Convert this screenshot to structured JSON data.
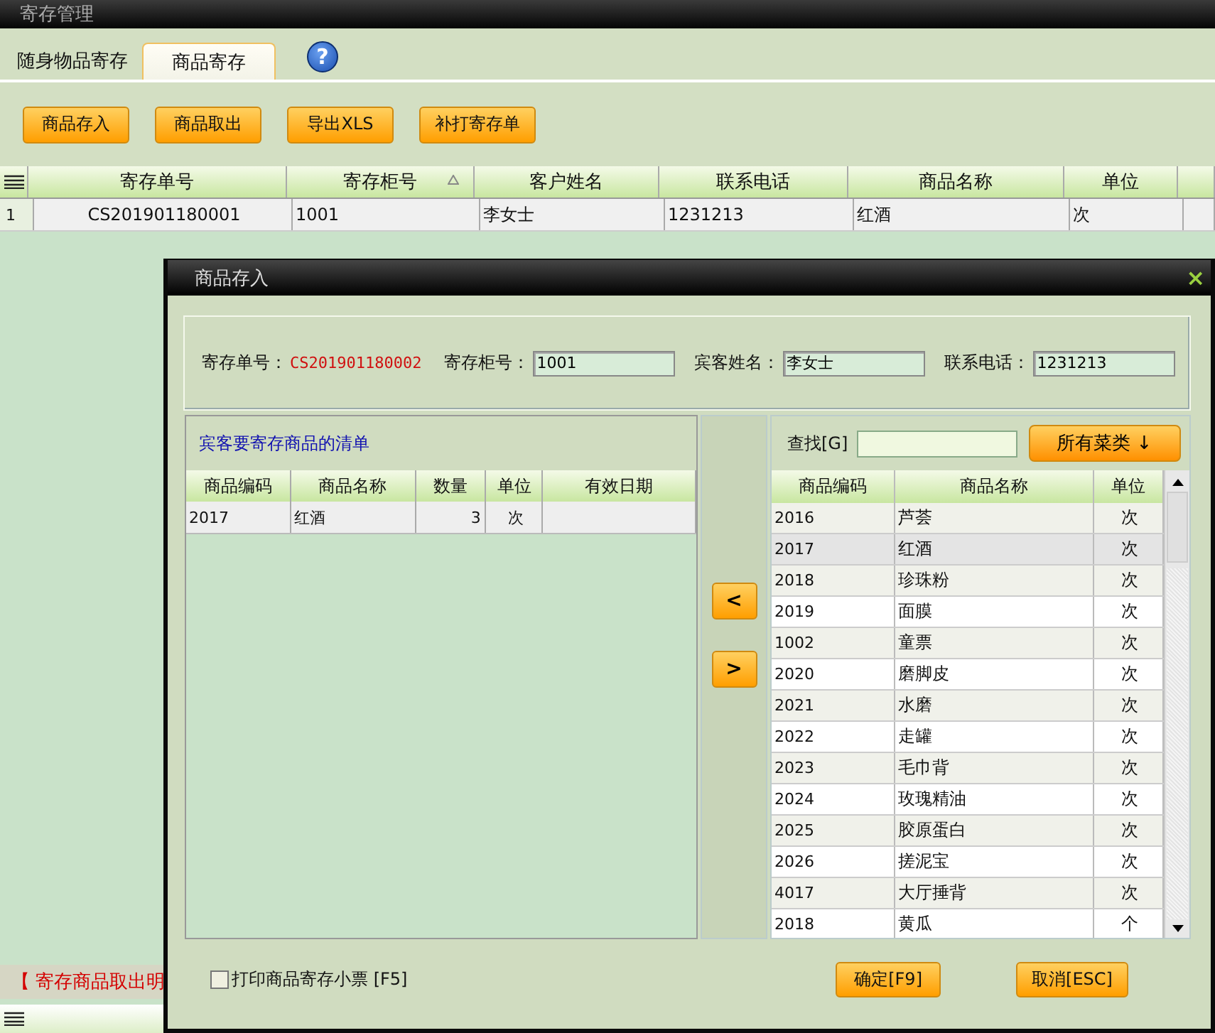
{
  "app_title": "寄存管理",
  "tabs": [
    {
      "label": "随身物品寄存",
      "selected": false
    },
    {
      "label": "商品寄存",
      "selected": true
    }
  ],
  "help_button": "?",
  "toolbar": [
    "商品存入",
    "商品取出",
    "导出XLS",
    "补打寄存单"
  ],
  "table": {
    "columns": [
      {
        "label": "寄存单号",
        "sorted": false
      },
      {
        "label": "寄存柜号",
        "sorted": true
      },
      {
        "label": "客户姓名",
        "sorted": false
      },
      {
        "label": "联系电话",
        "sorted": false
      },
      {
        "label": "商品名称",
        "sorted": false
      },
      {
        "label": "单位",
        "sorted": false
      }
    ],
    "rows": [
      {
        "number": "1",
        "cells": [
          "CS201901180001",
          "1001",
          "李女士",
          "1231213",
          "红酒",
          "次"
        ]
      }
    ]
  },
  "detail_bar": "【 寄存商品取出明",
  "dialog": {
    "title": "商品存入",
    "close": "×",
    "order_label": "寄存单号：",
    "order_number": "CS201901180002",
    "fields": [
      {
        "label": "寄存柜号：",
        "value": "1001"
      },
      {
        "label": "宾客姓名：",
        "value": "李女士"
      },
      {
        "label": "联系电话：",
        "value": "1231213"
      }
    ],
    "left_list": {
      "caption": "宾客要寄存商品的清单",
      "columns": [
        "商品编码",
        "商品名称",
        "数量",
        "单位",
        "有效日期"
      ],
      "rows": [
        [
          "2017",
          "红酒",
          "3",
          "次",
          ""
        ]
      ]
    },
    "move_buttons": [
      "<",
      ">"
    ],
    "search_label": "查找[G]",
    "category_button": "所有菜类 ↓",
    "right_list": {
      "columns": [
        "商品编码",
        "商品名称",
        "单位"
      ],
      "rows": [
        {
          "code": "2016",
          "name": "芦荟",
          "unit": "次",
          "selected": false
        },
        {
          "code": "2017",
          "name": "红酒",
          "unit": "次",
          "selected": true
        },
        {
          "code": "2018",
          "name": "珍珠粉",
          "unit": "次",
          "selected": false
        },
        {
          "code": "2019",
          "name": "面膜",
          "unit": "次",
          "selected": false
        },
        {
          "code": "1002",
          "name": "童票",
          "unit": "次",
          "selected": false
        },
        {
          "code": "2020",
          "name": "磨脚皮",
          "unit": "次",
          "selected": false
        },
        {
          "code": "2021",
          "name": "水磨",
          "unit": "次",
          "selected": false
        },
        {
          "code": "2022",
          "name": "走罐",
          "unit": "次",
          "selected": false
        },
        {
          "code": "2023",
          "name": "毛巾背",
          "unit": "次",
          "selected": false
        },
        {
          "code": "2024",
          "name": "玫瑰精油",
          "unit": "次",
          "selected": false
        },
        {
          "code": "2025",
          "name": "胶原蛋白",
          "unit": "次",
          "selected": false
        },
        {
          "code": "2026",
          "name": "搓泥宝",
          "unit": "次",
          "selected": false
        },
        {
          "code": "4017",
          "name": "大厅捶背",
          "unit": "次",
          "selected": false
        },
        {
          "code": "2018",
          "name": "黄瓜",
          "unit": "个",
          "selected": false
        }
      ]
    },
    "print_checkbox": {
      "label": "打印商品寄存小票 [F5]",
      "checked": false
    },
    "buttons": [
      "确定[F9]",
      "取消[ESC]"
    ]
  }
}
